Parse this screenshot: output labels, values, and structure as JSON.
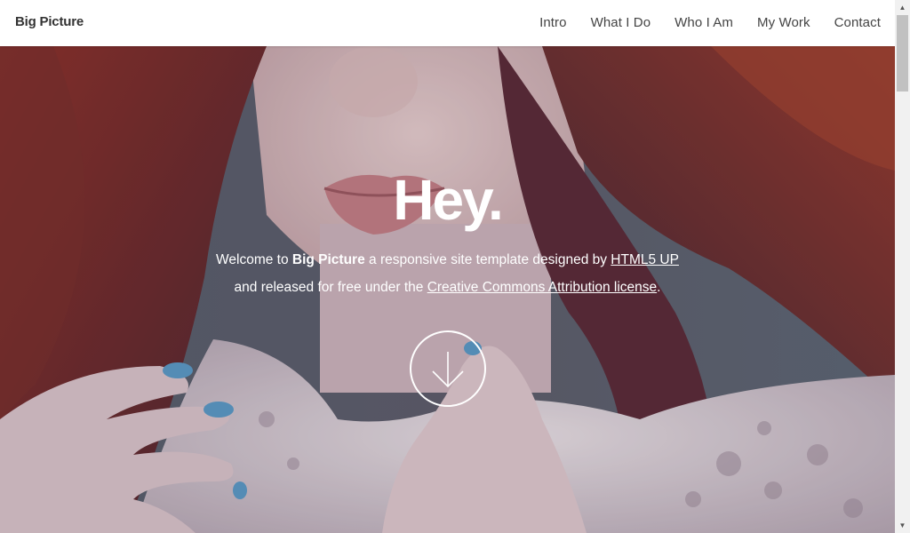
{
  "header": {
    "logo": "Big Picture",
    "nav": [
      "Intro",
      "What I Do",
      "Who I Am",
      "My Work",
      "Contact"
    ]
  },
  "hero": {
    "title": "Hey.",
    "line1_prefix": "Welcome to ",
    "line1_bold": "Big Picture",
    "line1_mid": " a responsive site template designed by ",
    "line1_link": "HTML5 UP",
    "line2_prefix": "and released for free under the ",
    "line2_link": "Creative Commons Attribution license",
    "line2_suffix": "."
  },
  "icons": {
    "scroll_down": "arrow-down-circle-icon",
    "scroll_up_arrow": "▲",
    "scroll_down_arrow": "▼"
  },
  "colors": {
    "header_bg": "#ffffff",
    "text_dark": "#333333",
    "hero_text": "#ffffff",
    "hair": "#8a2e28",
    "nails": "#5b9bc8"
  }
}
